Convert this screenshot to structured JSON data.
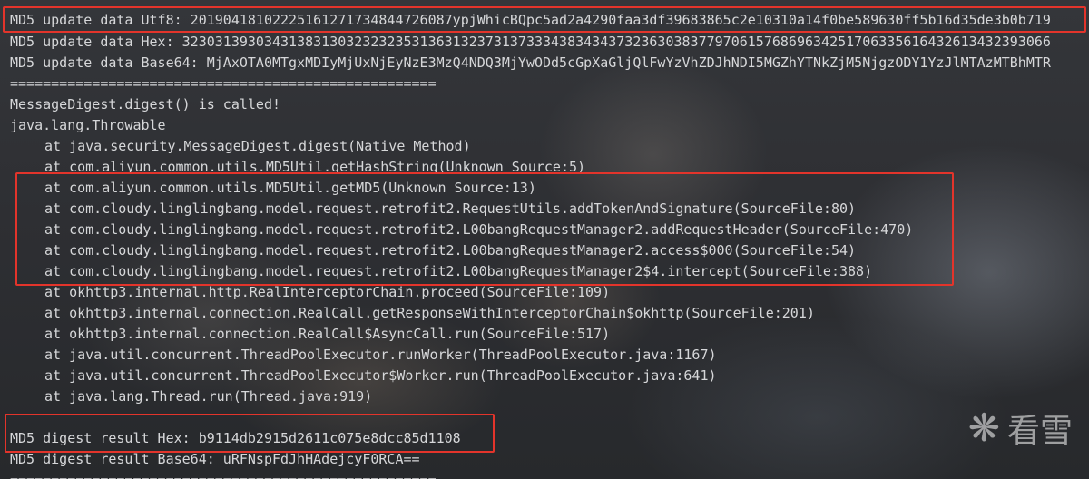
{
  "console": {
    "lines": [
      "MD5 update data Utf8: 20190418102225161271734844726087ypjWhicBQpc5ad2a4290faa3df39683865c2e10310a14f0be589630ff5b16d35de3b0b719",
      "MD5 update data Hex: 3230313930343138313032323235313631323731373334383434373236303837797061576869634251706335616432613432393066",
      "MD5 update data Base64: MjAxOTA0MTgxMDIyMjUxNjEyNzE3MzQ4NDQ3MjYwODd5cGpXaGljQlFwYzVhZDJhNDI5MGZhYTNkZjM5NjgzODY1YzJlMTAzMTBhMTR",
      "====================================================",
      "MessageDigest.digest() is called!",
      "java.lang.Throwable",
      "at java.security.MessageDigest.digest(Native Method)",
      "at com.aliyun.common.utils.MD5Util.getHashString(Unknown Source:5)",
      "at com.aliyun.common.utils.MD5Util.getMD5(Unknown Source:13)",
      "at com.cloudy.linglingbang.model.request.retrofit2.RequestUtils.addTokenAndSignature(SourceFile:80)",
      "at com.cloudy.linglingbang.model.request.retrofit2.L00bangRequestManager2.addRequestHeader(SourceFile:470)",
      "at com.cloudy.linglingbang.model.request.retrofit2.L00bangRequestManager2.access$000(SourceFile:54)",
      "at com.cloudy.linglingbang.model.request.retrofit2.L00bangRequestManager2$4.intercept(SourceFile:388)",
      "at okhttp3.internal.http.RealInterceptorChain.proceed(SourceFile:109)",
      "at okhttp3.internal.connection.RealCall.getResponseWithInterceptorChain$okhttp(SourceFile:201)",
      "at okhttp3.internal.connection.RealCall$AsyncCall.run(SourceFile:517)",
      "at java.util.concurrent.ThreadPoolExecutor.runWorker(ThreadPoolExecutor.java:1167)",
      "at java.util.concurrent.ThreadPoolExecutor$Worker.run(ThreadPoolExecutor.java:641)",
      "at java.lang.Thread.run(Thread.java:919)",
      "",
      "MD5 digest result Hex: b9114db2915d2611c075e8dcc85d1108",
      "MD5 digest result Base64: uRFNspFdJhHAdejcyF0RCA==",
      "===================================================="
    ]
  },
  "watermark": {
    "icon": "snowflake-icon",
    "text": "看雪"
  },
  "colors": {
    "text": "#d6d7d9",
    "highlight_box": "#e3342b",
    "background": "#2b2d30"
  }
}
